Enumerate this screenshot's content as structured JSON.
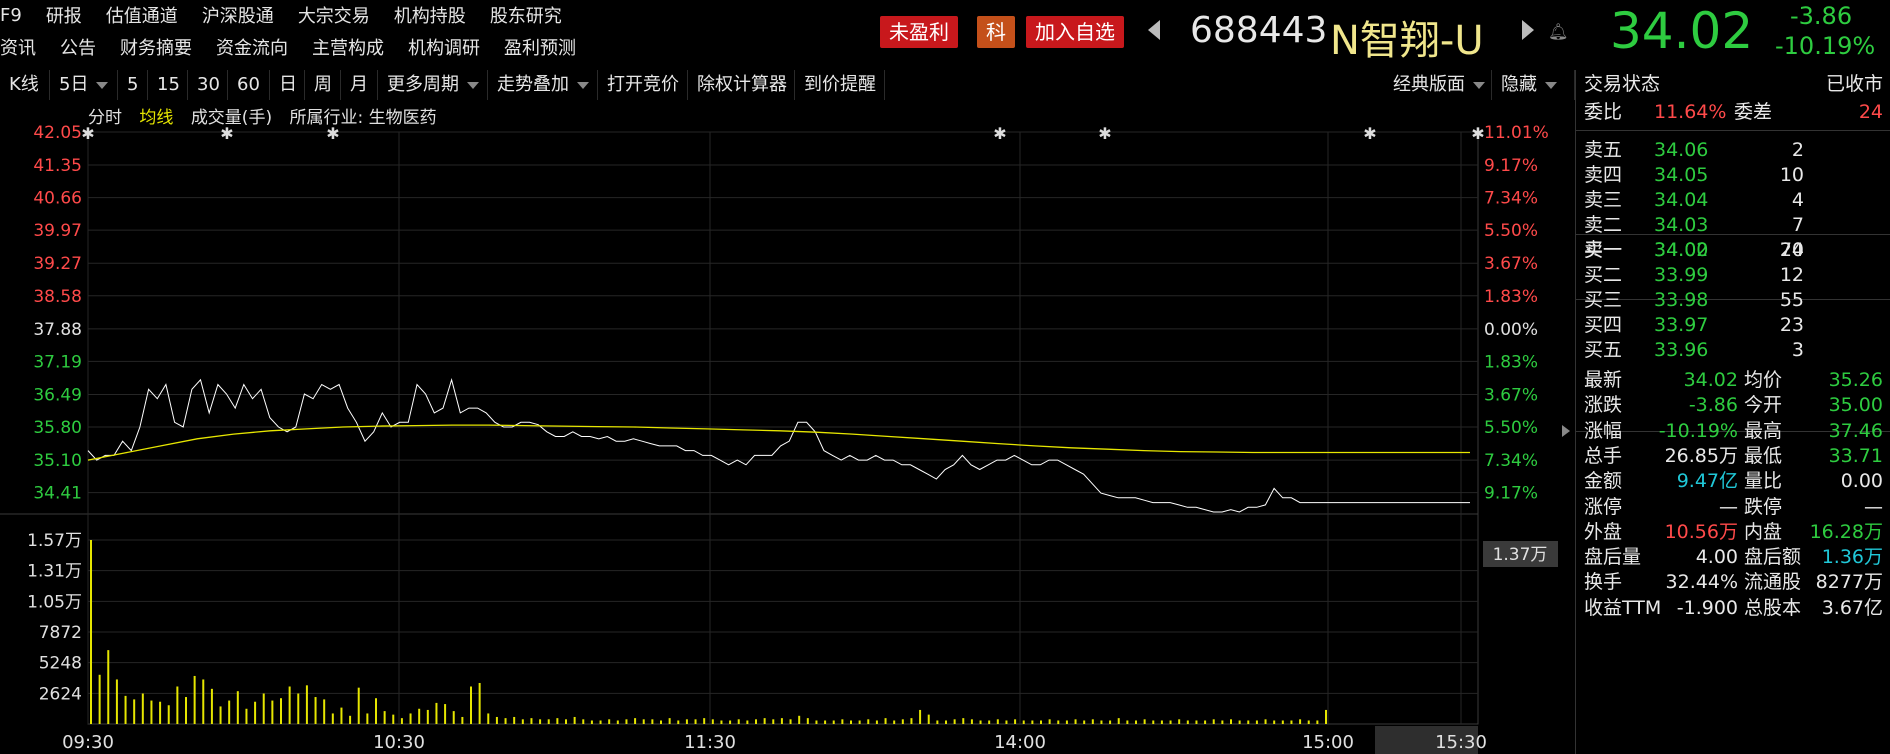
{
  "nav": {
    "row1": [
      "F9",
      "研报",
      "估值通道",
      "沪深股通",
      "大宗交易",
      "机构持股",
      "股东研究"
    ],
    "row2": [
      "资讯",
      "公告",
      "财务摘要",
      "资金流向",
      "主营构成",
      "机构调研",
      "盈利预测"
    ]
  },
  "header": {
    "badge_loss": "未盈利",
    "badge_board": "科",
    "add_watch": "加入自选",
    "code": "688443",
    "name": "N智翔-U",
    "price": "34.02",
    "change": "-3.86",
    "change_pct": "-10.19%",
    "colors": {
      "down": "#2ecc40",
      "up": "#ff4a4a",
      "avg_line": "#e6e600",
      "price_line": "#ffffff"
    }
  },
  "toolbar": {
    "items": [
      "K线",
      "5日",
      "5",
      "15",
      "30",
      "60",
      "日",
      "周",
      "月",
      "更多周期",
      "走势叠加",
      "打开竞价",
      "除权计算器",
      "到价提醒"
    ],
    "layout_label": "经典版面",
    "hide_label": "隐藏"
  },
  "legend": {
    "minute": "分时",
    "avg": "均线",
    "volume": "成交量(手)",
    "industry": "所属行业: 生物医药"
  },
  "chart_data": {
    "type": "line",
    "prev_close": 37.88,
    "ylim": [
      34.0,
      42.05
    ],
    "y_ticks_left": [
      "42.05",
      "41.35",
      "40.66",
      "39.97",
      "39.27",
      "38.58",
      "37.88",
      "37.19",
      "36.49",
      "35.80",
      "35.10",
      "34.41"
    ],
    "y_ticks_right": [
      "11.01%",
      "9.17%",
      "7.34%",
      "5.50%",
      "3.67%",
      "1.83%",
      "0.00%",
      "1.83%",
      "3.67%",
      "5.50%",
      "7.34%",
      "9.17%"
    ],
    "x_ticks": [
      "09:30",
      "10:30",
      "11:30",
      "14:00",
      "15:00",
      "15:30"
    ],
    "volume_ticks": [
      "1.57万",
      "1.31万",
      "1.05万",
      "7872",
      "5248",
      "2624"
    ],
    "volume_marker": "1.37万",
    "volume_max": 15700,
    "series": [
      {
        "values": [
          35.3,
          35.1,
          35.2,
          35.2,
          35.5,
          35.3,
          35.8,
          36.6,
          36.4,
          36.7,
          35.9,
          35.8,
          36.6,
          36.8,
          36.1,
          36.7,
          36.5,
          36.2,
          36.7,
          36.4,
          36.6,
          36.0,
          35.8,
          35.7,
          35.8,
          36.5,
          36.4,
          36.7,
          36.6,
          36.7,
          36.2,
          35.9,
          35.5,
          35.7,
          36.1,
          35.8,
          35.9,
          35.9,
          36.7,
          36.5,
          36.1,
          36.2,
          36.8,
          36.1,
          36.2,
          36.2,
          36.1,
          35.9,
          35.8,
          35.8,
          35.9,
          35.9,
          35.85,
          35.7,
          35.6,
          35.6,
          35.7,
          35.6,
          35.6,
          35.55,
          35.6,
          35.5,
          35.5,
          35.55,
          35.5,
          35.45,
          35.4,
          35.4,
          35.4,
          35.3,
          35.3,
          35.2,
          35.2,
          35.1,
          35.0,
          35.1,
          35.0,
          35.2,
          35.2,
          35.2,
          35.4,
          35.5,
          35.9,
          35.9,
          35.7,
          35.3,
          35.2,
          35.1,
          35.2,
          35.1,
          35.1,
          35.2,
          35.1,
          35.1,
          35.0,
          35.0,
          34.9,
          34.8,
          34.7,
          34.9,
          35.0,
          35.2,
          35.0,
          34.9,
          35.0,
          35.1,
          35.1,
          35.2,
          35.1,
          35.0,
          35.0,
          35.1,
          35.1,
          35.0,
          34.9,
          34.8,
          34.6,
          34.4,
          34.35,
          34.3,
          34.3,
          34.3,
          34.25,
          34.2,
          34.2,
          34.2,
          34.15,
          34.1,
          34.1,
          34.05,
          34.0,
          34.0,
          34.05,
          34.0,
          34.1,
          34.1,
          34.15,
          34.5,
          34.3,
          34.3,
          34.2,
          34.2,
          34.2,
          34.2
        ]
      },
      {
        "values": [
          35.1,
          35.25,
          35.4,
          35.55,
          35.65,
          35.72,
          35.76,
          35.8,
          35.82,
          35.83,
          35.84,
          35.84,
          35.83,
          35.82,
          35.81,
          35.8,
          35.78,
          35.76,
          35.74,
          35.72,
          35.69,
          35.65,
          35.6,
          35.55,
          35.5,
          35.45,
          35.4,
          35.36,
          35.33,
          35.3,
          35.28,
          35.27,
          35.26,
          35.26,
          35.26
        ]
      }
    ],
    "volume": [
      15700,
      4200,
      6300,
      3800,
      2400,
      2100,
      2600,
      2000,
      1900,
      1600,
      3200,
      2300,
      4100,
      3800,
      3000,
      1500,
      2000,
      2800,
      1300,
      1900,
      2600,
      2000,
      2200,
      3200,
      2600,
      3300,
      2300,
      2100,
      900,
      1400,
      700,
      3100,
      900,
      2200,
      1100,
      800,
      500,
      900,
      1300,
      1200,
      1800,
      1700,
      1100,
      600,
      3200,
      3500,
      900,
      600,
      500,
      600,
      400,
      500,
      400,
      400,
      500,
      400,
      600,
      400,
      300,
      300,
      400,
      300,
      400,
      500,
      400,
      400,
      300,
      500,
      300,
      400,
      400,
      500,
      400,
      300,
      300,
      400,
      300,
      400,
      500,
      400,
      500,
      400,
      700,
      500,
      300,
      300,
      300,
      400,
      300,
      300,
      400,
      300,
      500,
      300,
      400,
      500,
      1200,
      800,
      300,
      300,
      400,
      500,
      400,
      300,
      300,
      400,
      300,
      400,
      300,
      300,
      300,
      400,
      300,
      300,
      400,
      300,
      400,
      300,
      300,
      500,
      300,
      300,
      400,
      300,
      300,
      300,
      400,
      300,
      300,
      300,
      400,
      300,
      400,
      300,
      300,
      300,
      400,
      300,
      300,
      300,
      400,
      300,
      300,
      1200
    ]
  },
  "panel": {
    "status_label": "交易状态",
    "status_value": "已收市",
    "weibi_label": "委比",
    "weibi_value": "11.64%",
    "weicha_label": "委差",
    "weicha_value": "24",
    "asks": [
      {
        "label": "卖五",
        "price": "34.06",
        "vol": "2"
      },
      {
        "label": "卖四",
        "price": "34.05",
        "vol": "10"
      },
      {
        "label": "卖三",
        "price": "34.04",
        "vol": "4"
      },
      {
        "label": "卖二",
        "price": "34.03",
        "vol": "7"
      },
      {
        "label": "卖一",
        "price": "34.02",
        "vol": "70"
      }
    ],
    "bids": [
      {
        "label": "买一",
        "price": "34.00",
        "vol": "24"
      },
      {
        "label": "买二",
        "price": "33.99",
        "vol": "12"
      },
      {
        "label": "买三",
        "price": "33.98",
        "vol": "55"
      },
      {
        "label": "买四",
        "price": "33.97",
        "vol": "23"
      },
      {
        "label": "买五",
        "price": "33.96",
        "vol": "3"
      }
    ],
    "stats": [
      {
        "l1": "最新",
        "v1": "34.02",
        "c1": "green",
        "l2": "均价",
        "v2": "35.26",
        "c2": "green"
      },
      {
        "l1": "涨跌",
        "v1": "-3.86",
        "c1": "green",
        "l2": "今开",
        "v2": "35.00",
        "c2": "green"
      },
      {
        "l1": "涨幅",
        "v1": "-10.19%",
        "c1": "green",
        "l2": "最高",
        "v2": "37.46",
        "c2": "green"
      },
      {
        "l1": "总手",
        "v1": "26.85万",
        "c1": "white",
        "l2": "最低",
        "v2": "33.71",
        "c2": "green"
      },
      {
        "l1": "金额",
        "v1": "9.47亿",
        "c1": "cyan",
        "l2": "量比",
        "v2": "0.00",
        "c2": "white"
      },
      {
        "l1": "涨停",
        "v1": "—",
        "c1": "white",
        "l2": "跌停",
        "v2": "—",
        "c2": "white"
      },
      {
        "l1": "外盘",
        "v1": "10.56万",
        "c1": "red",
        "l2": "内盘",
        "v2": "16.28万",
        "c2": "green"
      },
      {
        "l1": "盘后量",
        "v1": "4.00",
        "c1": "white",
        "l2": "盘后额",
        "v2": "1.36万",
        "c2": "cyan"
      },
      {
        "l1": "换手",
        "v1": "32.44%",
        "c1": "white",
        "l2": "流通股",
        "v2": "8277万",
        "c2": "white"
      },
      {
        "l1": "收益TTM",
        "v1": "-1.900",
        "c1": "white",
        "l2": "总股本",
        "v2": "3.67亿",
        "c2": "white"
      }
    ]
  }
}
